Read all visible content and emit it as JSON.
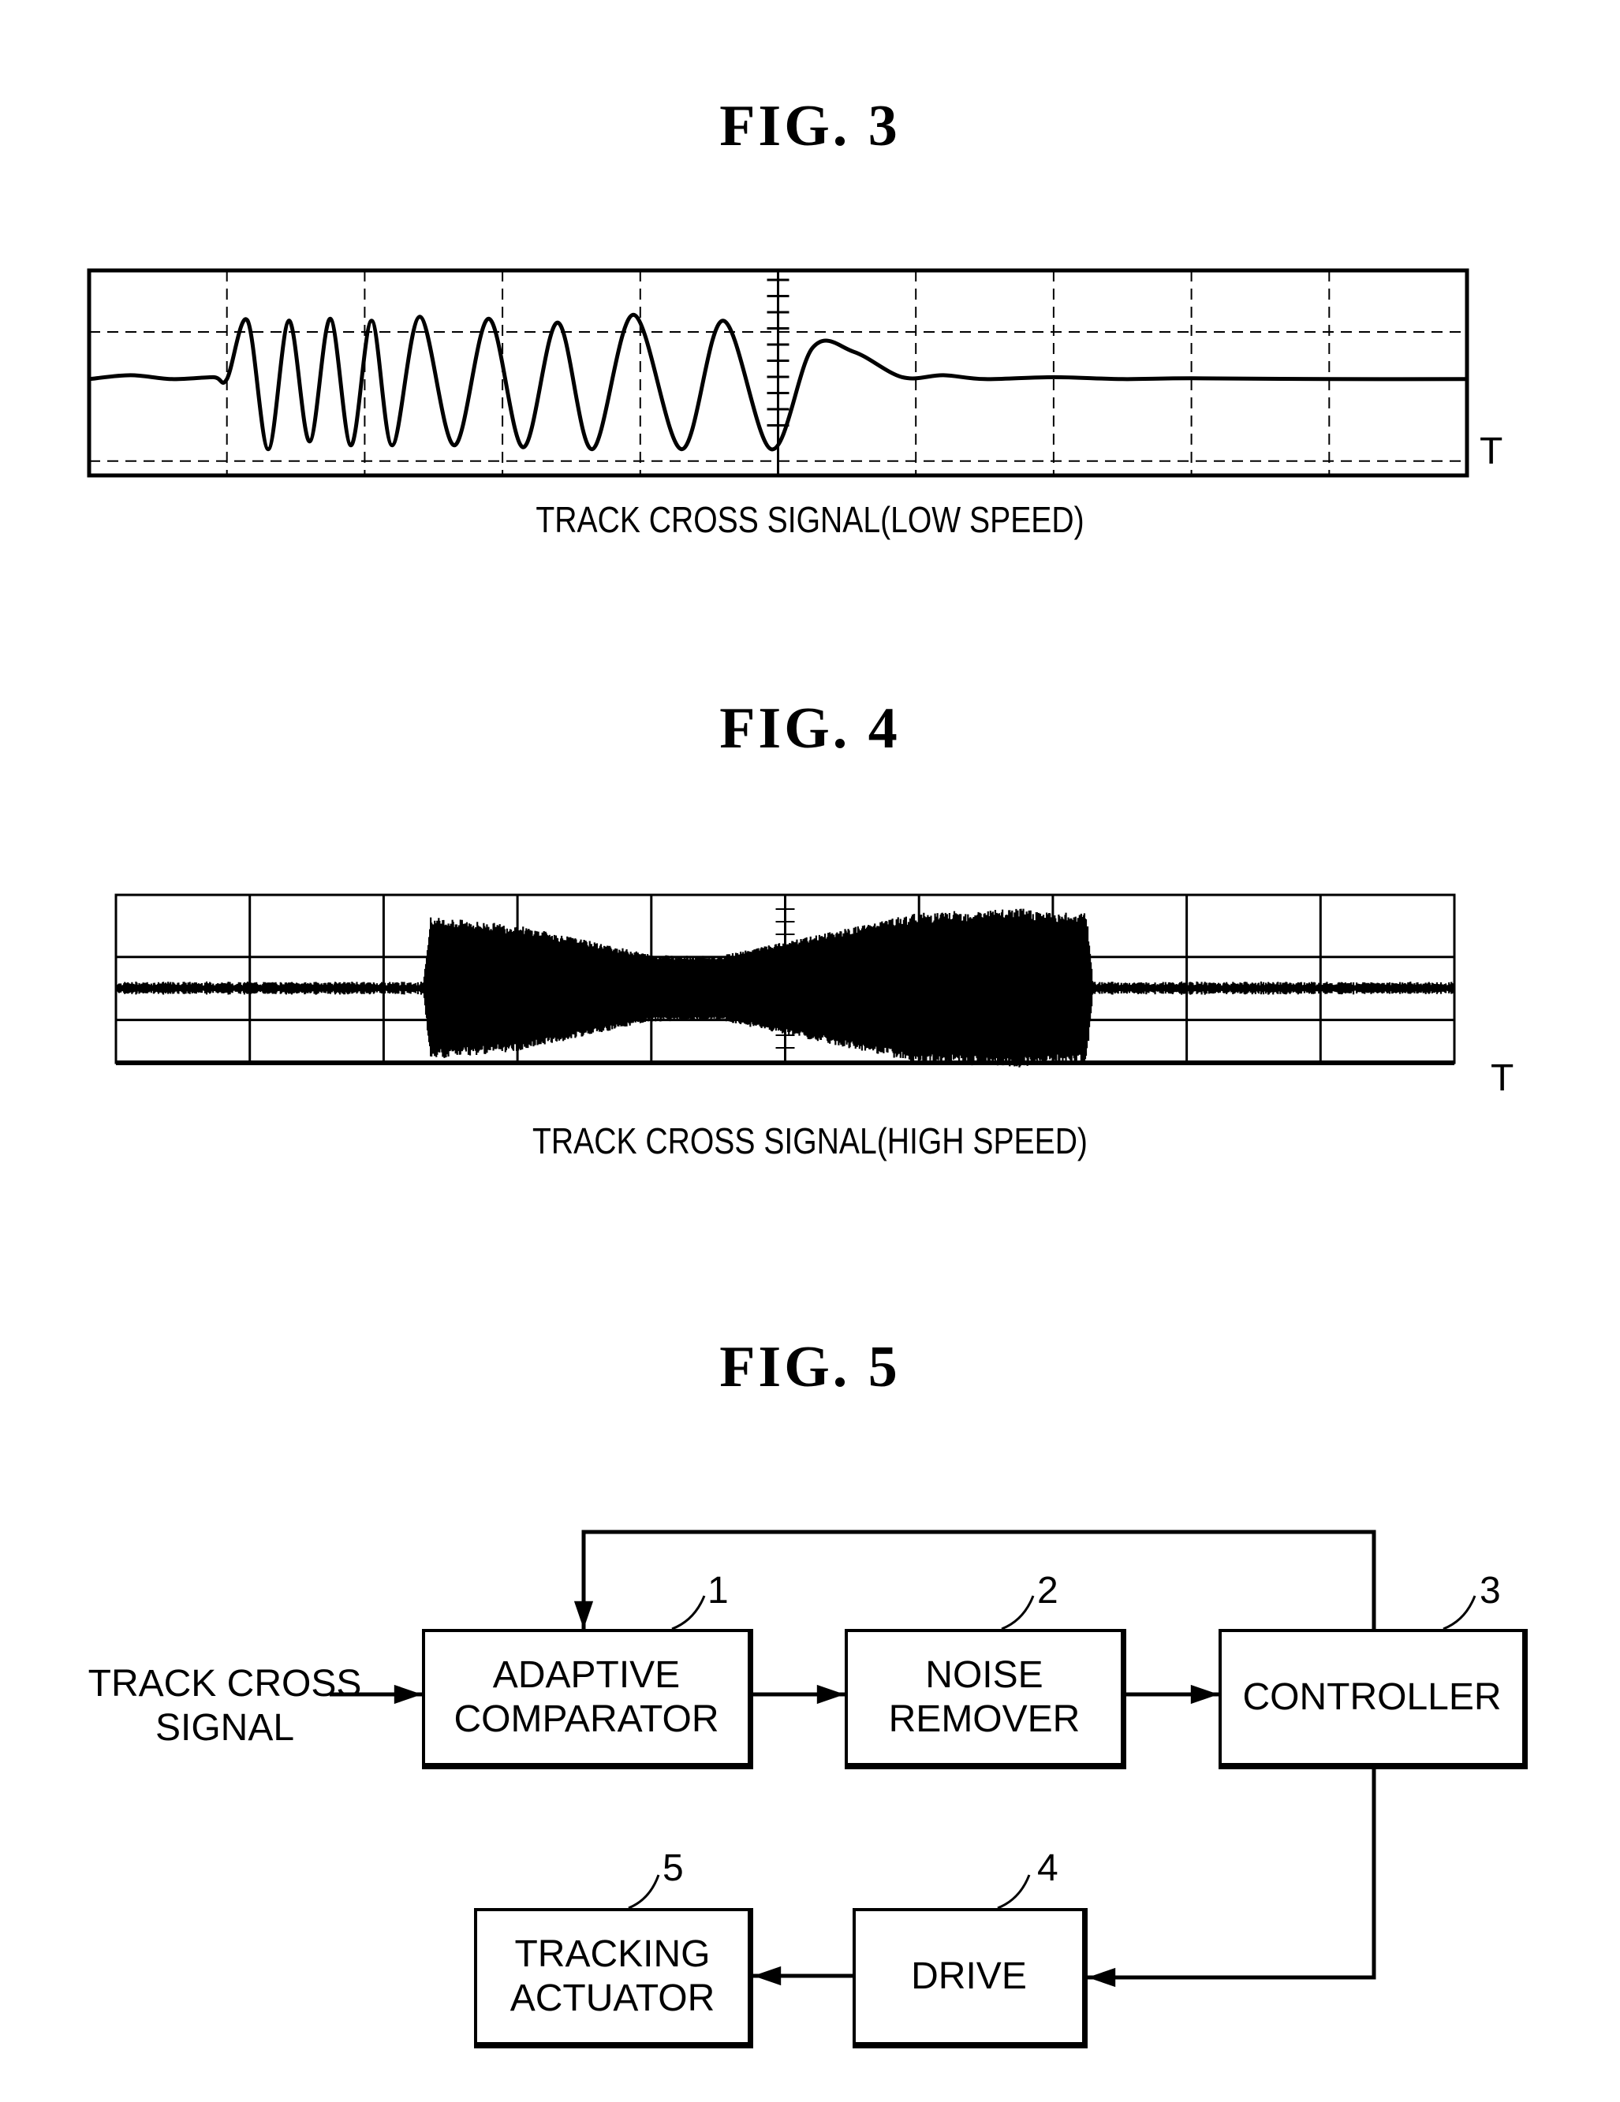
{
  "figures": [
    {
      "title": "FIG. 3",
      "caption": "TRACK CROSS SIGNAL(LOW SPEED)",
      "axis_label": "T"
    },
    {
      "title": "FIG. 4",
      "caption": "TRACK CROSS SIGNAL(HIGH SPEED)",
      "axis_label": "T"
    },
    {
      "title": "FIG. 5"
    }
  ],
  "chart_data": [
    {
      "type": "line",
      "title": "FIG. 3",
      "xlabel": "T",
      "caption": "TRACK CROSS SIGNAL(LOW SPEED)",
      "grid": true,
      "grid_divisions_x": 10,
      "grid_divisions_y": 4,
      "description": "Baseline, then ~7 large sinusoidal oscillations with increasing period, one deep trough, small overshoot, then baseline",
      "x": [
        0,
        0.3,
        0.6,
        0.9,
        1.0,
        1.15,
        1.3,
        1.45,
        1.6,
        1.75,
        1.9,
        2.05,
        2.2,
        2.4,
        2.65,
        2.9,
        3.15,
        3.4,
        3.65,
        3.95,
        4.3,
        4.6,
        4.95,
        5.25,
        5.55,
        5.9,
        6.2,
        6.5,
        7.0,
        7.5,
        8.0,
        9.0,
        10.0
      ],
      "y": [
        0,
        0.1,
        0,
        0.05,
        0,
        1.5,
        -1.8,
        1.5,
        -1.6,
        1.55,
        -1.7,
        1.5,
        -1.7,
        1.6,
        -1.7,
        1.55,
        -1.75,
        1.45,
        -1.8,
        1.65,
        -1.8,
        1.5,
        -1.8,
        0.8,
        0.7,
        0.05,
        0.1,
        0,
        0.05,
        0,
        0.02,
        0,
        0
      ],
      "ylim": [
        -2,
        2
      ],
      "xlim": [
        0,
        10
      ]
    },
    {
      "type": "area",
      "title": "FIG. 4",
      "xlabel": "T",
      "caption": "TRACK CROSS SIGNAL(HIGH SPEED)",
      "grid": true,
      "grid_divisions_x": 10,
      "grid_divisions_y": 3,
      "description": "Noise floor, then dense high-frequency burst with envelope narrowing in the middle (bowtie shape)",
      "envelope_x": [
        0,
        2.3,
        2.35,
        3.0,
        4.0,
        4.5,
        5.0,
        6.0,
        6.8,
        7.0,
        7.25,
        7.3,
        10.0
      ],
      "envelope_amplitude": [
        0.08,
        0.08,
        0.85,
        0.75,
        0.4,
        0.38,
        0.55,
        0.9,
        0.95,
        0.9,
        0.9,
        0.08,
        0.08
      ],
      "ylim": [
        -1.5,
        1.5
      ],
      "xlim": [
        0,
        10
      ]
    }
  ],
  "diagram": {
    "input_label": "TRACK\nCROSS SIGNAL",
    "blocks": [
      {
        "id": "1",
        "label": "ADAPTIVE\nCOMPARATOR"
      },
      {
        "id": "2",
        "label": "NOISE\nREMOVER"
      },
      {
        "id": "3",
        "label": "CONTROLLER"
      },
      {
        "id": "4",
        "label": "DRIVE"
      },
      {
        "id": "5",
        "label": "TRACKING\nACTUATOR"
      }
    ],
    "connections": [
      {
        "from": "input",
        "to": "1"
      },
      {
        "from": "1",
        "to": "2"
      },
      {
        "from": "2",
        "to": "3"
      },
      {
        "from": "3",
        "to": "1",
        "kind": "feedback"
      },
      {
        "from": "3",
        "to": "4"
      },
      {
        "from": "4",
        "to": "5"
      }
    ]
  }
}
